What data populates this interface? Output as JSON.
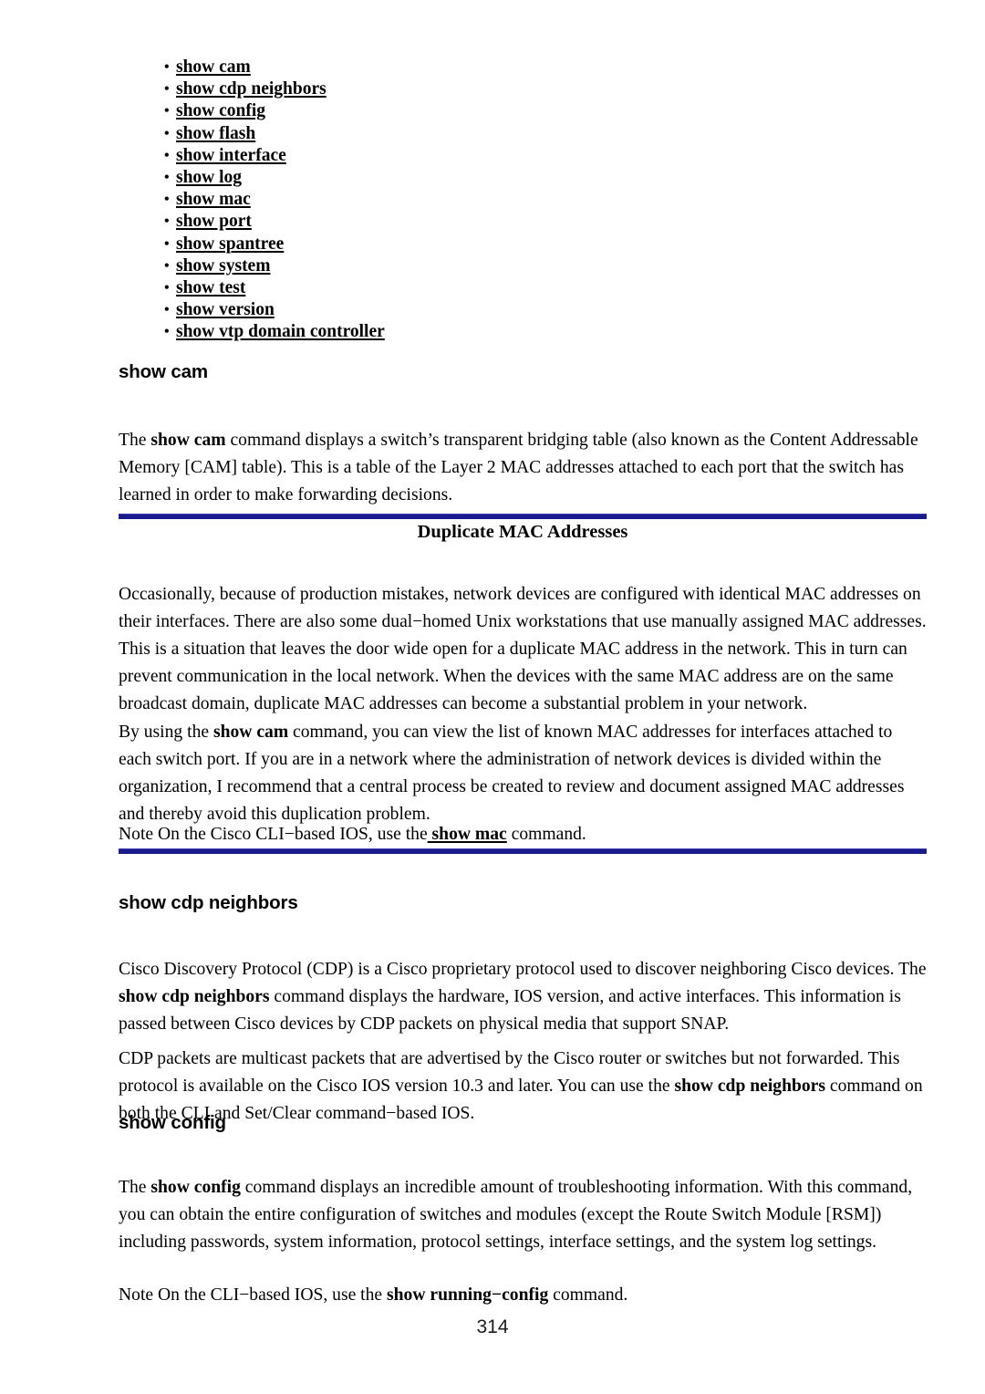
{
  "document": {
    "page_number": "314"
  },
  "command_list": {
    "bullet_glyph": "•",
    "items": [
      {
        "label": "show cam"
      },
      {
        "label": "show cdp neighbors"
      },
      {
        "label": "show config"
      },
      {
        "label": "show flash"
      },
      {
        "label": "show interface"
      },
      {
        "label": "show log"
      },
      {
        "label": "show mac"
      },
      {
        "label": "show port"
      },
      {
        "label": "show spantree"
      },
      {
        "label": "show system"
      },
      {
        "label": "show test"
      },
      {
        "label": "show version"
      },
      {
        "label": "show vtp domain controller"
      }
    ]
  },
  "sections": {
    "show_cam": {
      "heading": "show cam",
      "paragraph": {
        "part1": "The ",
        "bold1": "show cam",
        "part2": " command displays a switch’s transparent bridging table (also known as the Content Addressable Memory [CAM] table). This is a table of the Layer 2 MAC addresses attached to each port that the switch has learned in order to make forwarding decisions."
      }
    },
    "sidebar": {
      "title": "Duplicate MAC Addresses",
      "paragraph1": "Occasionally, because of production mistakes, network devices are configured with identical MAC addresses on their interfaces. There are also some dual−homed Unix workstations that use manually assigned MAC addresses. This is a situation that leaves the door wide open for a duplicate MAC address in the network. This in turn can prevent communication in the local network. When the devices with the same MAC address are on the same broadcast domain, duplicate MAC addresses can become a substantial problem in your network.",
      "paragraph2": {
        "part1": "By using the ",
        "bold1": "show cam",
        "part2": " command, you can view the list of known MAC addresses for interfaces attached to each switch port. If you are in a network where the administration of network devices is divided within the organization, I recommend that a central process be created to review and document assigned MAC addresses and thereby avoid this duplication problem."
      },
      "note": {
        "label": "Note",
        "part1": " On the Cisco CLI−based IOS, use the",
        "underlined_bold": " show mac",
        "part2": " command."
      }
    },
    "show_cdp_neighbors": {
      "heading": "show cdp neighbors",
      "paragraph1": {
        "part1": "Cisco Discovery Protocol (CDP) is a Cisco proprietary protocol used to discover neighboring Cisco devices. The ",
        "bold1": "show cdp neighbors",
        "part2": " command displays the hardware, IOS version, and active interfaces. This information is passed between Cisco devices by CDP packets on physical media that support SNAP."
      },
      "paragraph2": {
        "part1": "CDP packets are multicast packets that are advertised by the Cisco router or switches but not forwarded. This protocol is available on the Cisco IOS version 10.3 and later. You can use the ",
        "bold1": "show cdp neighbors",
        "part2": " command on both the CLI and Set/Clear command−based IOS."
      }
    },
    "show_config": {
      "heading": "show config",
      "paragraph": {
        "part1": "The ",
        "bold1": "show config",
        "part2": " command displays an incredible amount of troubleshooting information. With this command, you can obtain the entire configuration of switches and modules (except the Route Switch Module [RSM]) including passwords, system information, protocol settings, interface settings, and the system log settings."
      },
      "note": {
        "label": "Note",
        "part1": " On the CLI−based IOS, use the ",
        "bold1": "show running−config",
        "part2": " command."
      }
    }
  },
  "colors": {
    "rule_navy": "#1a1a8c",
    "text_black": "#000000"
  }
}
